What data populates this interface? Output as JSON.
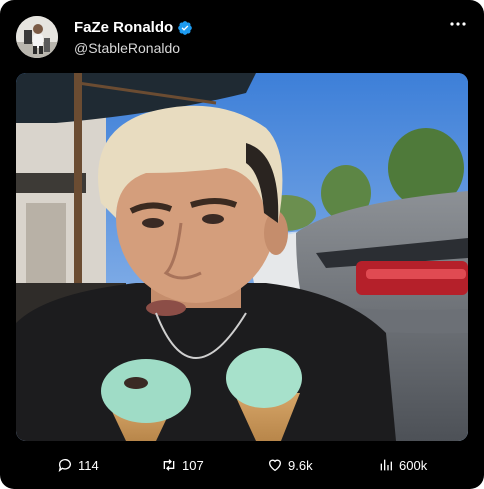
{
  "author": {
    "display_name": "FaZe Ronaldo",
    "handle": "@StableRonaldo",
    "verified": true,
    "avatar_icon": "avatar-photo"
  },
  "post": {
    "media_description_icon": "photo-man-eating-ice-cream-cones"
  },
  "actions": {
    "replies": "114",
    "reposts": "107",
    "likes": "9.6k",
    "views": "600k"
  },
  "colors": {
    "background": "#000000",
    "verified_badge": "#1d9bf0",
    "text": "#ffffff"
  }
}
